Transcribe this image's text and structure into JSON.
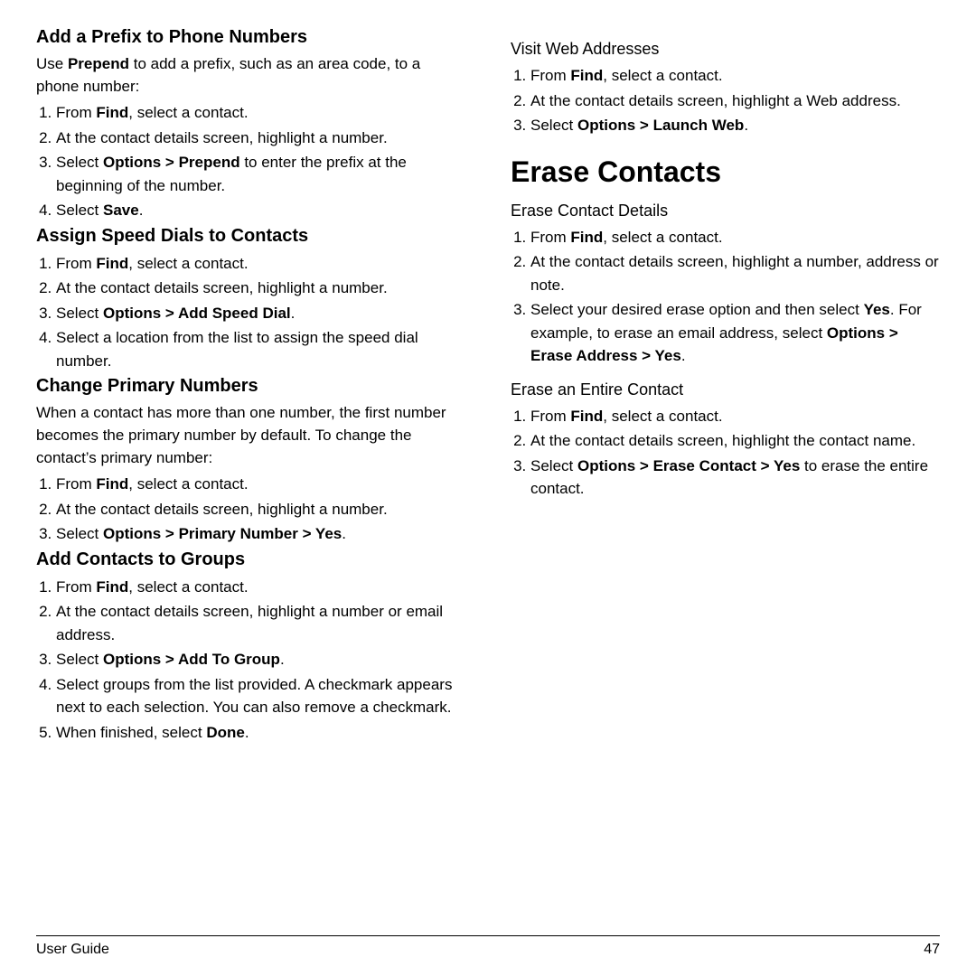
{
  "page": {
    "left_column": {
      "sections": [
        {
          "heading": "Add a Prefix to Phone Numbers",
          "intro": "Use Prepend to add a prefix, such as an area code, to a phone number:",
          "intro_bold": "Prepend",
          "steps": [
            "From <b>Find</b>, select a contact.",
            "At the contact details screen, highlight a number.",
            "Select <b>Options &gt; Prepend</b> to enter the prefix at the beginning of the number.",
            "Select <b>Save</b>."
          ]
        },
        {
          "heading": "Assign Speed Dials to Contacts",
          "steps": [
            "From <b>Find</b>, select a contact.",
            "At the contact details screen, highlight a number.",
            "Select <b>Options &gt; Add Speed Dial</b>.",
            "Select a location from the list to assign the speed dial number."
          ]
        },
        {
          "heading": "Change Primary Numbers",
          "intro": "When a contact has more than one number, the first number becomes the primary number by default. To change the contact’s primary number:",
          "steps": [
            "From <b>Find</b>, select a contact.",
            "At the contact details screen, highlight a number.",
            "Select <b>Options &gt; Primary Number &gt; Yes</b>."
          ]
        },
        {
          "heading": "Add Contacts to Groups",
          "steps": [
            "From <b>Find</b>, select a contact.",
            "At the contact details screen, highlight a number or email address.",
            "Select <b>Options &gt; Add To Group</b>.",
            "Select groups from the list provided. A checkmark appears next to each selection. You can also remove a checkmark.",
            "When finished, select <b>Done</b>."
          ]
        }
      ]
    },
    "right_column": {
      "visit_web": {
        "heading": "Visit Web Addresses",
        "steps": [
          "From <b>Find</b>, select a contact.",
          "At the contact details screen, highlight a Web address.",
          "Select <b>Options &gt; Launch Web</b>."
        ]
      },
      "erase_contacts": {
        "big_heading": "Erase Contacts",
        "subsections": [
          {
            "heading": "Erase Contact Details",
            "steps": [
              "From <b>Find</b>, select a contact.",
              "At the contact details screen, highlight a number, address or note.",
              "Select your desired erase option and then select <b>Yes</b>. For example, to erase an email address, select <b>Options &gt; Erase Address &gt; Yes</b>."
            ]
          },
          {
            "heading": "Erase an Entire Contact",
            "steps": [
              "From <b>Find</b>, select a contact.",
              "At the contact details screen, highlight the contact name.",
              "Select <b>Options &gt; Erase Contact &gt; Yes</b> to erase the entire contact."
            ]
          }
        ]
      }
    },
    "footer": {
      "left": "User Guide",
      "right": "47"
    }
  }
}
